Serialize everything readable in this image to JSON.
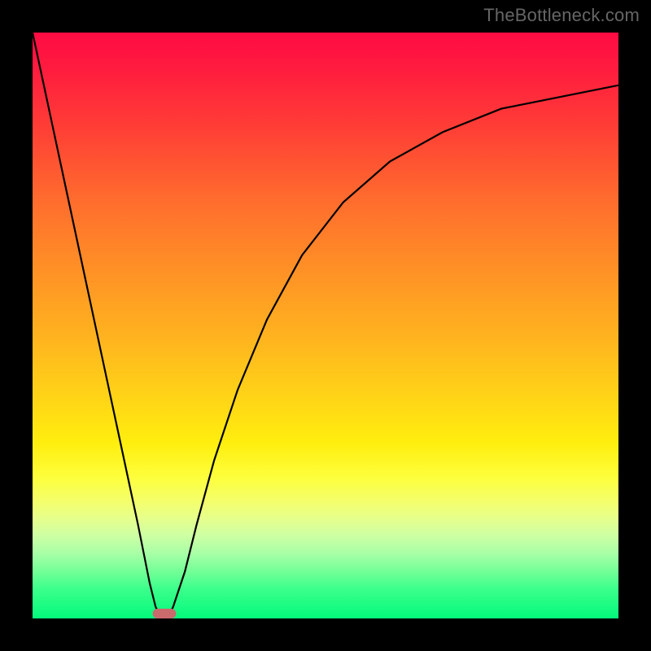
{
  "watermark": "TheBottleneck.com",
  "chart_data": {
    "type": "line",
    "title": "",
    "xlabel": "",
    "ylabel": "",
    "xlim": [
      0,
      100
    ],
    "ylim": [
      0,
      100
    ],
    "series": [
      {
        "name": "bottleneck-v-curve",
        "points": [
          {
            "x": 0,
            "y": 100
          },
          {
            "x": 3,
            "y": 86
          },
          {
            "x": 6,
            "y": 72
          },
          {
            "x": 9,
            "y": 58
          },
          {
            "x": 12,
            "y": 44
          },
          {
            "x": 15,
            "y": 30
          },
          {
            "x": 18,
            "y": 16
          },
          {
            "x": 20,
            "y": 6
          },
          {
            "x": 21,
            "y": 2
          },
          {
            "x": 22,
            "y": 0
          },
          {
            "x": 23,
            "y": 0
          },
          {
            "x": 24,
            "y": 2
          },
          {
            "x": 26,
            "y": 8
          },
          {
            "x": 28,
            "y": 16
          },
          {
            "x": 31,
            "y": 27
          },
          {
            "x": 35,
            "y": 39
          },
          {
            "x": 40,
            "y": 51
          },
          {
            "x": 46,
            "y": 62
          },
          {
            "x": 53,
            "y": 71
          },
          {
            "x": 61,
            "y": 78
          },
          {
            "x": 70,
            "y": 83
          },
          {
            "x": 80,
            "y": 87
          },
          {
            "x": 90,
            "y": 89
          },
          {
            "x": 100,
            "y": 91
          }
        ]
      }
    ],
    "marker": {
      "name": "optimal-band",
      "x_start": 20.5,
      "x_end": 24.5,
      "y": 0
    },
    "background_gradient": {
      "top_color": "#ff0b43",
      "bottom_color": "#03f97c",
      "meaning": "severity scale (red = high bottleneck, green = low)"
    }
  }
}
